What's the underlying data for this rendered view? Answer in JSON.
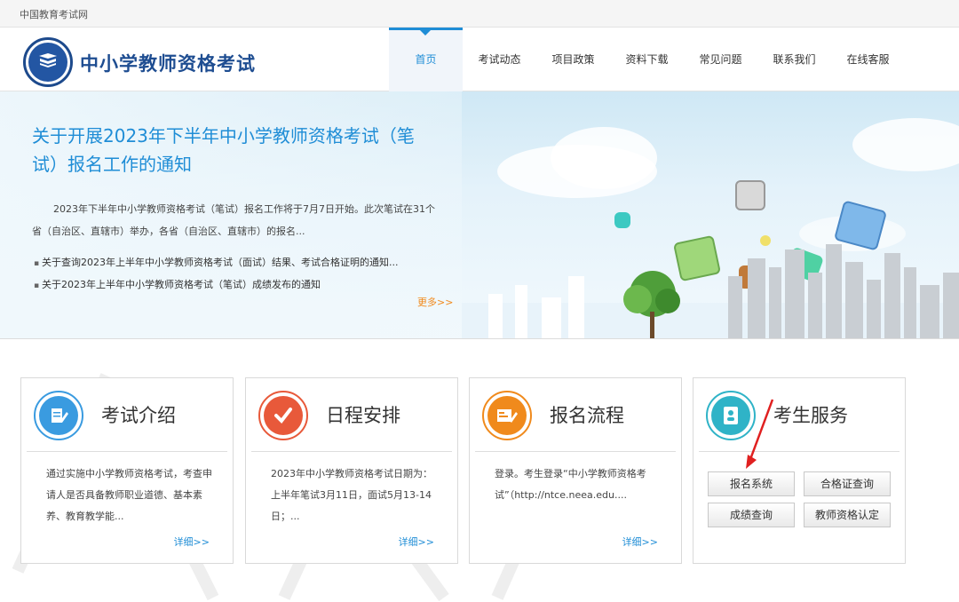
{
  "topbar": {
    "site_name": "中国教育考试网"
  },
  "header": {
    "brand": "中小学教师资格考试",
    "nav": [
      {
        "label": "首页",
        "active": true
      },
      {
        "label": "考试动态"
      },
      {
        "label": "项目政策"
      },
      {
        "label": "资料下载"
      },
      {
        "label": "常见问题"
      },
      {
        "label": "联系我们"
      },
      {
        "label": "在线客服"
      }
    ]
  },
  "banner": {
    "headline": "关于开展2023年下半年中小学教师资格考试（笔试）报名工作的通知",
    "summary": "2023年下半年中小学教师资格考试（笔试）报名工作将于7月7日开始。此次笔试在31个省（自治区、直辖市）举办，各省（自治区、直辖市）的报名...",
    "list": [
      "关于查询2023年上半年中小学教师资格考试（面试）结果、考试合格证明的通知...",
      "关于2023年上半年中小学教师资格考试（笔试）成绩发布的通知"
    ],
    "more": "更多>>"
  },
  "cards": [
    {
      "title": "考试介绍",
      "icon": "document-pen-icon",
      "body": "通过实施中小学教师资格考试，考查申请人是否具备教师职业道德、基本素养、教育教学能...",
      "detail": "详细>>",
      "color": "#3a9be0"
    },
    {
      "title": "日程安排",
      "icon": "checkmark-icon",
      "body": "2023年中小学教师资格考试日期为：上半年笔试3月11日，面试5月13-14日；...",
      "detail": "详细>>",
      "color": "#e8593a"
    },
    {
      "title": "报名流程",
      "icon": "form-edit-icon",
      "body": "登录。考生登录“中小学教师资格考试”（http://ntce.neea.edu....",
      "detail": "详细>>",
      "color": "#f08a1c"
    },
    {
      "title": "考生服务",
      "icon": "id-card-icon",
      "color": "#2fb3c7",
      "buttons": [
        "报名系统",
        "合格证查询",
        "成绩查询",
        "教师资格认定"
      ]
    }
  ]
}
